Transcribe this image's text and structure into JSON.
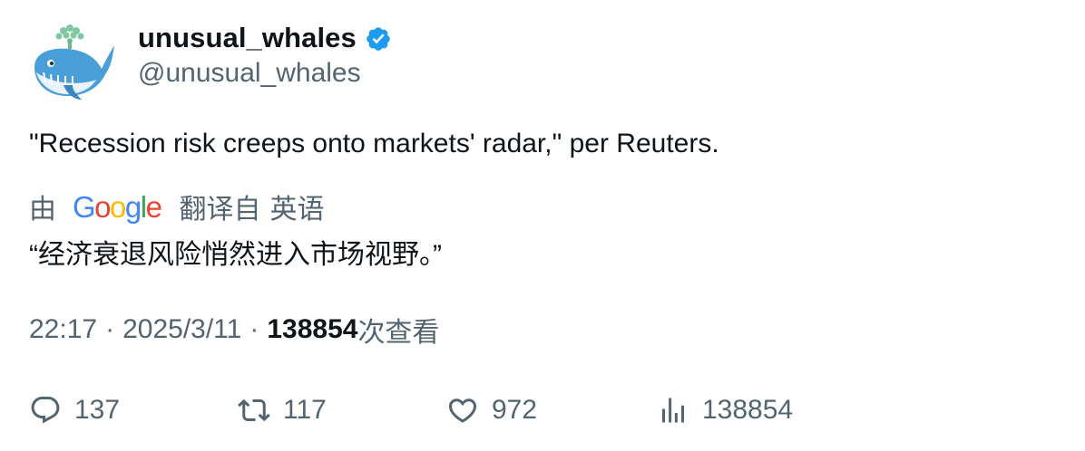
{
  "author": {
    "display_name": "unusual_whales",
    "handle": "@unusual_whales",
    "verified_icon": "verified-badge-icon",
    "avatar_icon": "whale-avatar"
  },
  "tweet": {
    "text": "\"Recession risk creeps onto markets' radar,\" per Reuters."
  },
  "translation": {
    "by_label": "由",
    "provider": "Google",
    "translated_from_label": "翻译自",
    "source_language": "英语",
    "translated_text": "“经济衰退风险悄然进入市场视野。”"
  },
  "meta": {
    "time": "22:17",
    "separator": "·",
    "date": "2025/3/11",
    "views_count": "138854",
    "views_label": "次查看"
  },
  "actions": {
    "replies": "137",
    "retweets": "117",
    "likes": "972",
    "views": "138854"
  },
  "colors": {
    "text_primary": "#0f1419",
    "text_secondary": "#536471",
    "verified_blue": "#1d9bf0",
    "google_blue": "#4285F4",
    "google_red": "#EA4335",
    "google_yellow": "#FBBC05",
    "google_green": "#34A853"
  }
}
